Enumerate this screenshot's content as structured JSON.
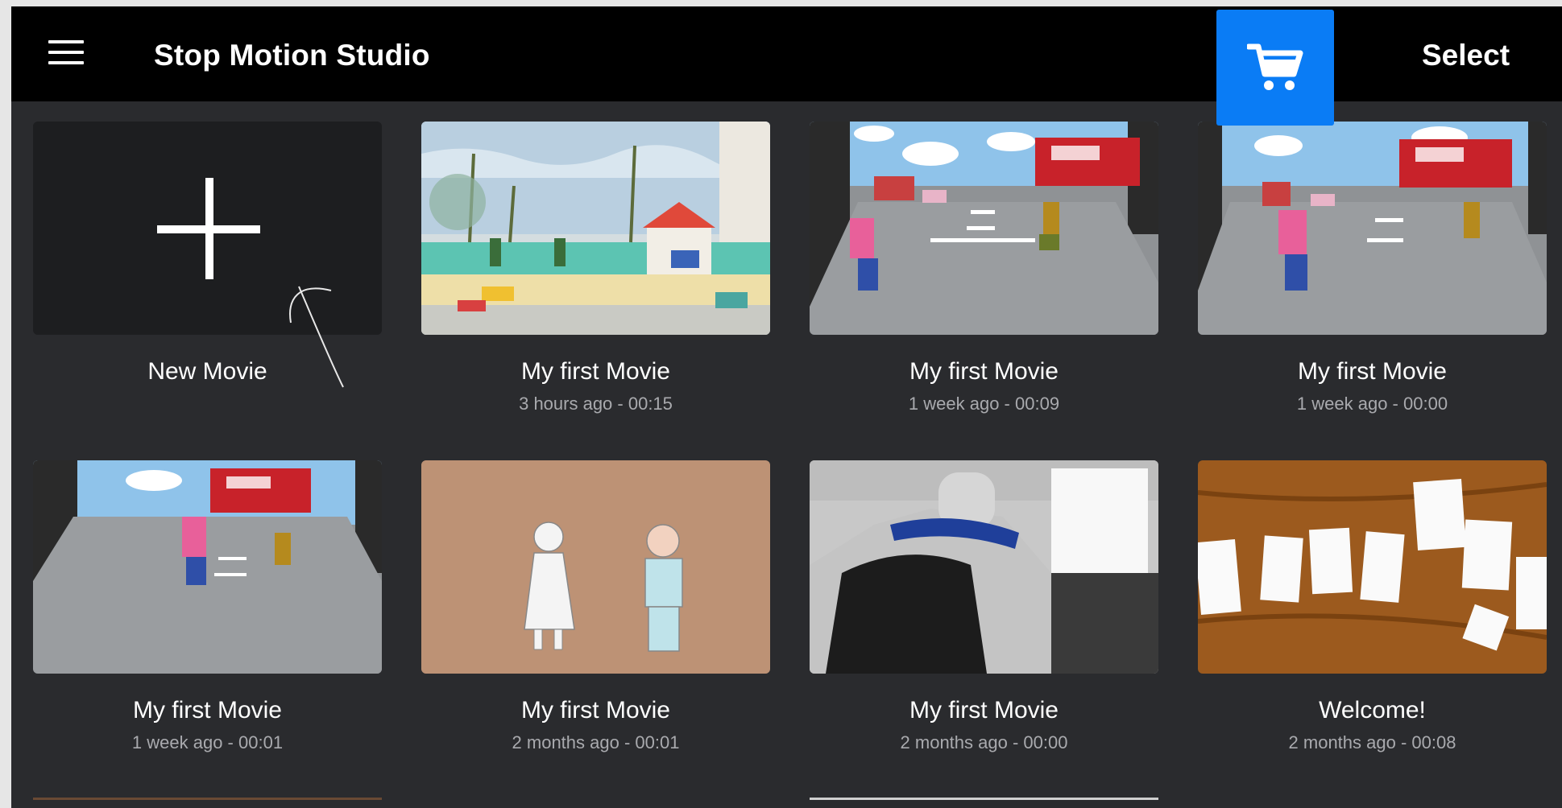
{
  "app": {
    "title": "Stop Motion Studio",
    "select_label": "Select",
    "accent_color": "#0a7cf5"
  },
  "icons": {
    "menu": "hamburger-menu-icon",
    "cart": "shopping-cart-icon",
    "plus": "plus-icon"
  },
  "new_movie": {
    "label": "New Movie"
  },
  "movies": [
    {
      "title": "My first Movie",
      "meta": "3 hours ago - 00:15",
      "scene": "paper diorama with trees and house"
    },
    {
      "title": "My first Movie",
      "meta": "1 week ago - 00:09",
      "scene": "fire truck street scene"
    },
    {
      "title": "My first Movie",
      "meta": "1 week ago - 00:00",
      "scene": "fire truck street scene"
    },
    {
      "title": "My first Movie",
      "meta": "1 week ago - 00:01",
      "scene": "fire truck street scene"
    },
    {
      "title": "My first Movie",
      "meta": "2 months ago - 00:01",
      "scene": "paper cutout figures on wood"
    },
    {
      "title": "My first Movie",
      "meta": "2 months ago - 00:00",
      "scene": "car interior"
    },
    {
      "title": "Welcome!",
      "meta": "2 months ago - 00:08",
      "scene": "welcome letters on wood"
    }
  ]
}
